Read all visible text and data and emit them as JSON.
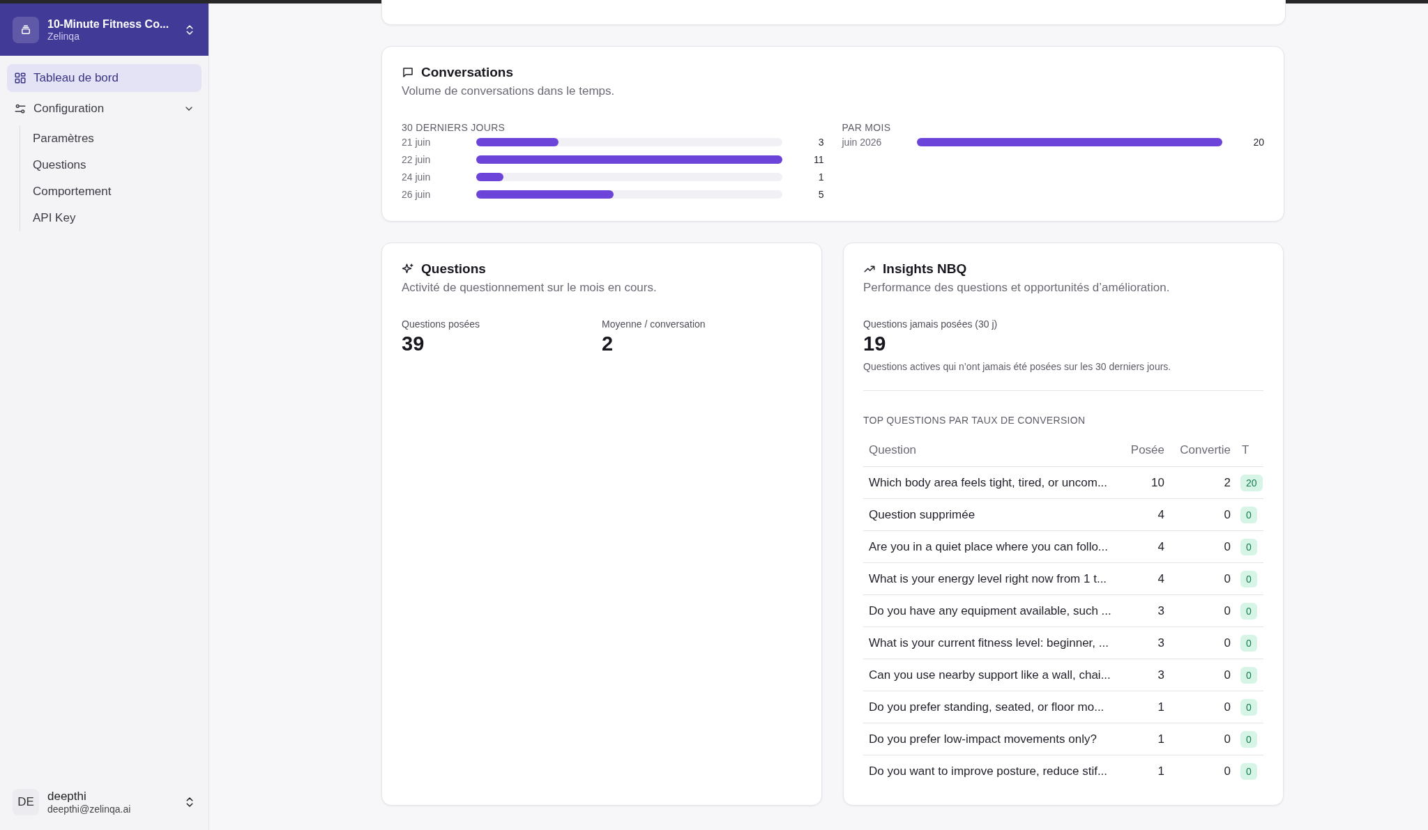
{
  "sidebar": {
    "workspace": {
      "name": "10-Minute Fitness Co...",
      "org": "Zelinqa"
    },
    "nav": [
      {
        "label": "Tableau de bord",
        "kind": "link",
        "selected": true
      },
      {
        "label": "Configuration",
        "kind": "group",
        "selected": false,
        "expanded": true,
        "children": [
          {
            "label": "Paramètres",
            "selected": false
          },
          {
            "label": "Questions",
            "selected": false
          },
          {
            "label": "Comportement",
            "selected": false
          },
          {
            "label": "API Key",
            "selected": false
          }
        ]
      }
    ],
    "user": {
      "initials": "DE",
      "name": "deepthi",
      "email": "deepthi@zelinqa.ai"
    }
  },
  "conversations": {
    "title": "Conversations",
    "subtitle": "Volume de conversations dans le temps.",
    "daily": {
      "label": "30 DERNIERS JOURS",
      "rows": [
        {
          "label": "21 juin",
          "value": "3",
          "level": 0.27
        },
        {
          "label": "22 juin",
          "value": "11",
          "level": 1
        },
        {
          "label": "24 juin",
          "value": "1",
          "level": 0.09
        },
        {
          "label": "26 juin",
          "value": "5",
          "level": 0.45
        }
      ]
    },
    "monthly": {
      "label": "PAR MOIS",
      "rows": [
        {
          "label": "juin 2026",
          "value": "20",
          "level": 1
        }
      ]
    }
  },
  "questions": {
    "title": "Questions",
    "subtitle": "Activité de questionnement sur le mois en cours.",
    "stats": [
      {
        "label": "Questions posées",
        "value": "39"
      },
      {
        "label": "Moyenne / conversation",
        "value": "2"
      }
    ]
  },
  "insights": {
    "title": "Insights NBQ",
    "subtitle": "Performance des questions et opportunités d’amélioration.",
    "stat": {
      "label": "Questions jamais posées (30 j)",
      "value": "19",
      "note": "Questions actives qui n’ont jamais été posées sur les 30 derniers jours."
    },
    "table": {
      "title": "TOP QUESTIONS PAR TAUX DE CONVERSION",
      "columns": [
        "Question",
        "Posée",
        "Convertie",
        "T"
      ],
      "rows": [
        [
          "Which body area feels tight, tired, or uncom...",
          "10",
          "2",
          "20"
        ],
        [
          "Question supprimée",
          "4",
          "0",
          "0"
        ],
        [
          "Are you in a quiet place where you can follo...",
          "4",
          "0",
          "0"
        ],
        [
          "What is your energy level right now from 1 t...",
          "4",
          "0",
          "0"
        ],
        [
          "Do you have any equipment available, such ...",
          "3",
          "0",
          "0"
        ],
        [
          "What is your current fitness level: beginner, ...",
          "3",
          "0",
          "0"
        ],
        [
          "Can you use nearby support like a wall, chai...",
          "3",
          "0",
          "0"
        ],
        [
          "Do you prefer standing, seated, or floor mo...",
          "1",
          "0",
          "0"
        ],
        [
          "Do you prefer low-impact movements only?",
          "1",
          "0",
          "0"
        ],
        [
          "Do you want to improve posture, reduce stif...",
          "1",
          "0",
          "0"
        ]
      ]
    }
  }
}
